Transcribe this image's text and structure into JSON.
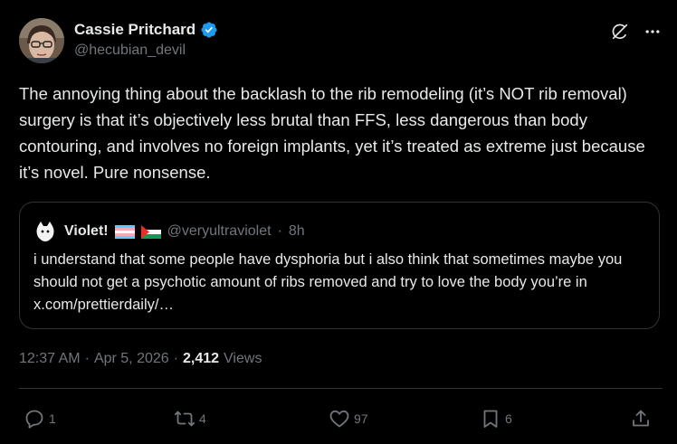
{
  "author": {
    "display_name": "Cassie Pritchard",
    "handle": "@hecubian_devil",
    "verified": true
  },
  "post": {
    "text": "The annoying thing about the backlash to the rib remodeling (it’s NOT rib removal) surgery is that it’s objectively less brutal than FFS, less dangerous than body contouring, and involves no foreign implants, yet it’s treated as extreme just because it’s novel. Pure nonsense."
  },
  "quoted": {
    "display_name": "Violet!",
    "handle": "@veryultraviolet",
    "separator": "·",
    "time": "8h",
    "text": "i understand that some people have dysphoria but i also think that sometimes maybe you should not get a psychotic amount of ribs removed and try to love the body you’re in x.com/prettierdaily/…"
  },
  "meta": {
    "time": "12:37 AM",
    "sep1": "·",
    "date": "Apr 5, 2026",
    "sep2": "·",
    "views_count": "2,412",
    "views_label": "Views"
  },
  "actions": {
    "replies": "1",
    "reposts": "4",
    "likes": "97",
    "bookmarks": "6"
  },
  "colors": {
    "background": "#000000",
    "text": "#e7e9ea",
    "secondary": "#71767b",
    "border": "#2f3336",
    "verified": "#1d9bf0"
  }
}
